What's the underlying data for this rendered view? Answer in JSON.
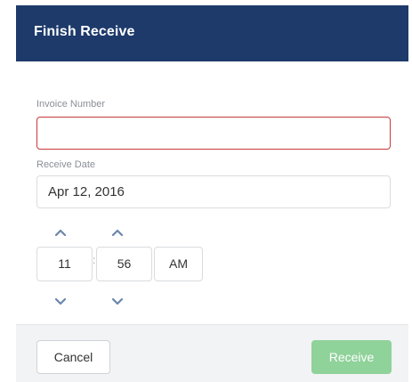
{
  "dialog": {
    "title": "Finish Receive"
  },
  "invoice": {
    "label": "Invoice Number",
    "value": "",
    "invalid": true,
    "border_color": "#c9393b"
  },
  "receive_date": {
    "label": "Receive Date",
    "value": "Apr 12, 2016"
  },
  "time": {
    "hours": "11",
    "minutes": "56",
    "meridiem": "AM",
    "separator": ":",
    "icons": {
      "increment": "chevron-up-icon",
      "decrement": "chevron-down-icon"
    }
  },
  "footer": {
    "cancel_label": "Cancel",
    "receive_label": "Receive"
  },
  "colors": {
    "header_bg": "#1d3a6b",
    "receive_bg": "#8fd29a",
    "arrow": "#6b86ab",
    "footer_bg": "#f2f3f4"
  }
}
